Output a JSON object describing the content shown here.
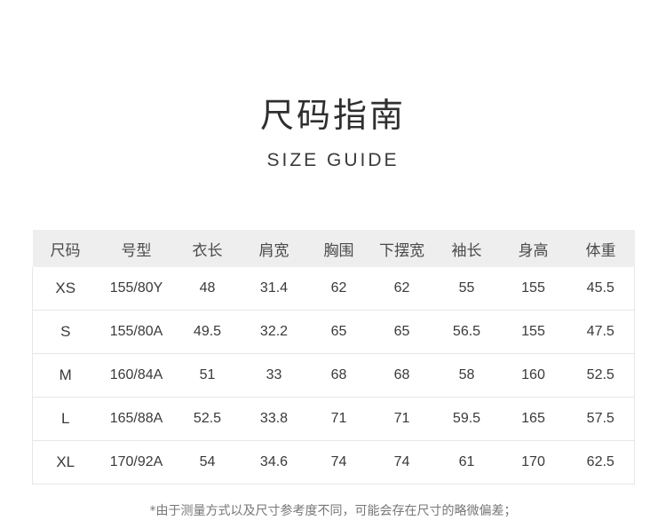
{
  "title": "尺码指南",
  "subtitle": "SIZE GUIDE",
  "table": {
    "headers": [
      "尺码",
      "号型",
      "衣长",
      "肩宽",
      "胸围",
      "下摆宽",
      "袖长",
      "身高",
      "体重"
    ],
    "rows": [
      [
        "XS",
        "155/80Y",
        "48",
        "31.4",
        "62",
        "62",
        "55",
        "155",
        "45.5"
      ],
      [
        "S",
        "155/80A",
        "49.5",
        "32.2",
        "65",
        "65",
        "56.5",
        "155",
        "47.5"
      ],
      [
        "M",
        "160/84A",
        "51",
        "33",
        "68",
        "68",
        "58",
        "160",
        "52.5"
      ],
      [
        "L",
        "165/88A",
        "52.5",
        "33.8",
        "71",
        "71",
        "59.5",
        "165",
        "57.5"
      ],
      [
        "XL",
        "170/92A",
        "54",
        "34.6",
        "74",
        "74",
        "61",
        "170",
        "62.5"
      ]
    ]
  },
  "note": "*由于测量方式以及尺寸参考度不同，可能会存在尺寸的略微偏差；"
}
